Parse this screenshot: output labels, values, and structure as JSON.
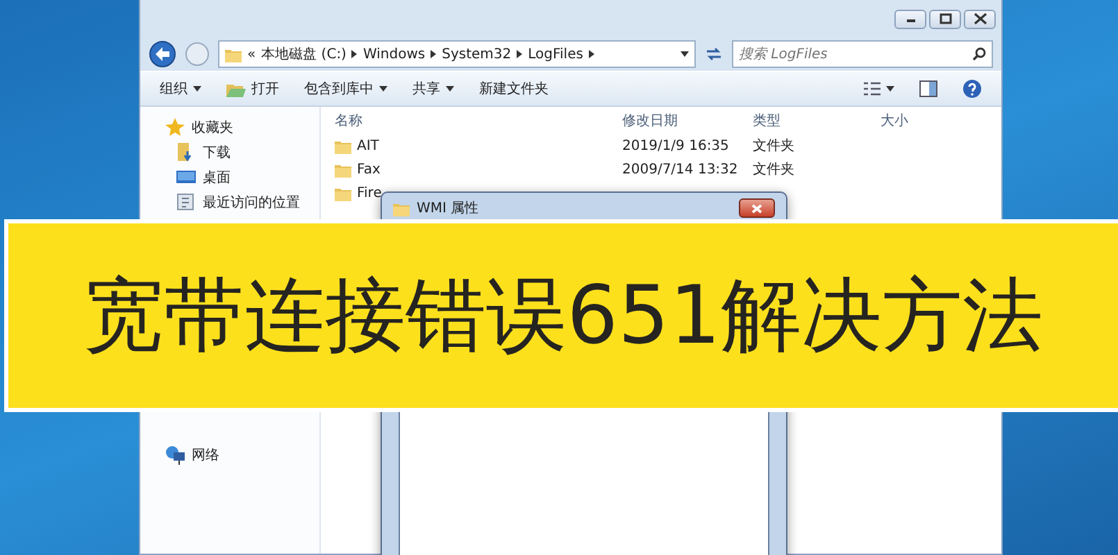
{
  "explorer": {
    "address": {
      "overflow_mark": "«",
      "segments": [
        "本地磁盘 (C:)",
        "Windows",
        "System32",
        "LogFiles"
      ]
    },
    "search": {
      "placeholder": "搜索 LogFiles"
    },
    "toolbar": [
      {
        "label": "组织",
        "kind": "menu"
      },
      {
        "label": "打开",
        "kind": "open"
      },
      {
        "label": "包含到库中",
        "kind": "menu"
      },
      {
        "label": "共享",
        "kind": "menu"
      },
      {
        "label": "新建文件夹",
        "kind": "plain"
      }
    ],
    "nav": [
      {
        "label": "收藏夹",
        "kind": "star",
        "children": [
          {
            "label": "下载",
            "kind": "download"
          },
          {
            "label": "桌面",
            "kind": "desktop"
          },
          {
            "label": "最近访问的位置",
            "kind": "recent"
          }
        ]
      },
      {
        "label": "网络",
        "kind": "network"
      }
    ],
    "columns": [
      "名称",
      "修改日期",
      "类型",
      "大小"
    ],
    "rows": [
      {
        "name": "AIT",
        "date": "2019/1/9 16:35",
        "type": "文件夹"
      },
      {
        "name": "Fax",
        "date": "2009/7/14 13:32",
        "type": "文件夹"
      },
      {
        "name": "Fire"
      }
    ]
  },
  "dialog": {
    "title": "WMI 属性"
  },
  "banner": {
    "text": "宽带连接错误651解决方法"
  }
}
